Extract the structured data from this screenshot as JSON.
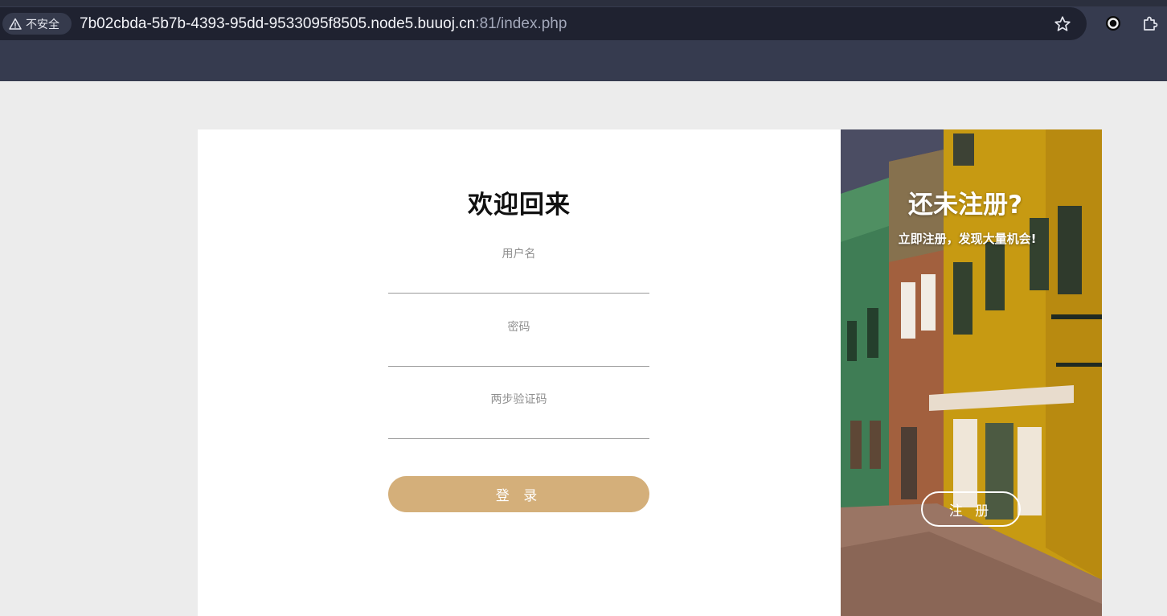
{
  "browser": {
    "security_label": "不安全",
    "url_host": "7b02cbda-5b7b-4393-95dd-9533095f8505.node5.buuoj.cn",
    "url_path": ":81/index.php"
  },
  "login": {
    "title": "欢迎回来",
    "username_label": "用户名",
    "password_label": "密码",
    "otp_label": "两步验证码",
    "submit_label": "登 录"
  },
  "register_panel": {
    "title": "还未注册?",
    "subtitle": "立即注册，发现大量机会!",
    "button_label": "注 册"
  },
  "colors": {
    "accent": "#d4af7a",
    "chrome": "#363b4f",
    "page_bg": "#ececec"
  }
}
